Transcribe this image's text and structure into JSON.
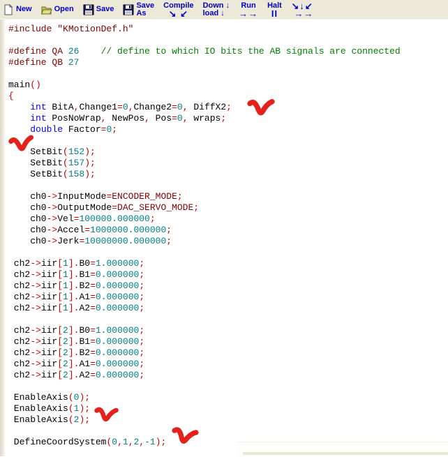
{
  "toolbar": {
    "text_color": "#0000C8",
    "background": "#ECE9D8",
    "buttons": [
      {
        "id": "new",
        "icon": "new-page-icon",
        "lines": [
          "New"
        ]
      },
      {
        "id": "open",
        "icon": "open-folder-icon",
        "lines": [
          "Open"
        ]
      },
      {
        "id": "save",
        "icon": "save-floppy-icon",
        "lines": [
          "Save"
        ]
      },
      {
        "id": "save-as",
        "icon": "save-floppy-icon",
        "lines": [
          "Save",
          "As"
        ]
      },
      {
        "id": "compile",
        "lines": [
          "Compile",
          "↘ ↙"
        ],
        "center": true
      },
      {
        "id": "download",
        "lines": [
          "Down ↓",
          "load ↓"
        ],
        "center": false
      },
      {
        "id": "run",
        "lines": [
          "Run",
          "→→"
        ],
        "center": true
      },
      {
        "id": "halt",
        "lines": [
          "Halt",
          "II"
        ],
        "center": true
      },
      {
        "id": "compile-download-run",
        "lines": [
          "↘↓↙",
          " →→"
        ],
        "center": true
      }
    ]
  },
  "editor": {
    "background": "#FFFFFF",
    "syntax_colors": {
      "keyword": "#0000FF",
      "number": "#008080",
      "operator": "#CC0000",
      "preprocessor_and_constants": "#800000",
      "comment": "#008000",
      "plain": "#000000"
    },
    "lines": [
      [
        [
          "pre",
          "#include \"KMotionDef.h\""
        ]
      ],
      [],
      [
        [
          "pre",
          "#define QA "
        ],
        [
          "num",
          "26"
        ],
        [
          "pl",
          "    "
        ],
        [
          "com",
          "// define to which IO bits the AB signals are connected"
        ]
      ],
      [
        [
          "pre",
          "#define QB "
        ],
        [
          "num",
          "27"
        ]
      ],
      [],
      [
        [
          "pl",
          "main"
        ],
        [
          "op",
          "()"
        ]
      ],
      [
        [
          "op",
          "{"
        ]
      ],
      [
        [
          "pl",
          "    "
        ],
        [
          "kw",
          "int"
        ],
        [
          "pl",
          " BitA"
        ],
        [
          "op",
          ","
        ],
        [
          "pl",
          "Change1"
        ],
        [
          "op",
          "="
        ],
        [
          "num",
          "0"
        ],
        [
          "op",
          ","
        ],
        [
          "pl",
          "Change2"
        ],
        [
          "op",
          "="
        ],
        [
          "num",
          "0"
        ],
        [
          "op",
          ","
        ],
        [
          "pl",
          " DiffX2"
        ],
        [
          "op",
          ";"
        ]
      ],
      [
        [
          "pl",
          "    "
        ],
        [
          "kw",
          "int"
        ],
        [
          "pl",
          " PosNoWrap"
        ],
        [
          "op",
          ","
        ],
        [
          "pl",
          " NewPos"
        ],
        [
          "op",
          ","
        ],
        [
          "pl",
          " Pos"
        ],
        [
          "op",
          "="
        ],
        [
          "num",
          "0"
        ],
        [
          "op",
          ","
        ],
        [
          "pl",
          " wraps"
        ],
        [
          "op",
          ";"
        ]
      ],
      [
        [
          "pl",
          "    "
        ],
        [
          "kw",
          "double"
        ],
        [
          "pl",
          " Factor"
        ],
        [
          "op",
          "="
        ],
        [
          "num",
          "0"
        ],
        [
          "op",
          ";"
        ]
      ],
      [],
      [
        [
          "pl",
          "    SetBit"
        ],
        [
          "op",
          "("
        ],
        [
          "num",
          "152"
        ],
        [
          "op",
          ");"
        ]
      ],
      [
        [
          "pl",
          "    SetBit"
        ],
        [
          "op",
          "("
        ],
        [
          "num",
          "157"
        ],
        [
          "op",
          ");"
        ]
      ],
      [
        [
          "pl",
          "    SetBit"
        ],
        [
          "op",
          "("
        ],
        [
          "num",
          "158"
        ],
        [
          "op",
          ");"
        ]
      ],
      [],
      [
        [
          "pl",
          "    ch0"
        ],
        [
          "op",
          "->"
        ],
        [
          "pl",
          "InputMode"
        ],
        [
          "op",
          "="
        ],
        [
          "pre",
          "ENCODER_MODE"
        ],
        [
          "op",
          ";"
        ]
      ],
      [
        [
          "pl",
          "    ch0"
        ],
        [
          "op",
          "->"
        ],
        [
          "pl",
          "OutputMode"
        ],
        [
          "op",
          "="
        ],
        [
          "pre",
          "DAC_SERVO_MODE"
        ],
        [
          "op",
          ";"
        ]
      ],
      [
        [
          "pl",
          "    ch0"
        ],
        [
          "op",
          "->"
        ],
        [
          "pl",
          "Vel"
        ],
        [
          "op",
          "="
        ],
        [
          "num",
          "100000.000000"
        ],
        [
          "op",
          ";"
        ]
      ],
      [
        [
          "pl",
          "    ch0"
        ],
        [
          "op",
          "->"
        ],
        [
          "pl",
          "Accel"
        ],
        [
          "op",
          "="
        ],
        [
          "num",
          "1000000.000000"
        ],
        [
          "op",
          ";"
        ]
      ],
      [
        [
          "pl",
          "    ch0"
        ],
        [
          "op",
          "->"
        ],
        [
          "pl",
          "Jerk"
        ],
        [
          "op",
          "="
        ],
        [
          "num",
          "10000000.000000"
        ],
        [
          "op",
          ";"
        ]
      ],
      [],
      [
        [
          "pl",
          " ch2"
        ],
        [
          "op",
          "->"
        ],
        [
          "pl",
          "iir"
        ],
        [
          "op",
          "["
        ],
        [
          "num",
          "1"
        ],
        [
          "op",
          "]."
        ],
        [
          "pl",
          "B0"
        ],
        [
          "op",
          "="
        ],
        [
          "num",
          "1.000000"
        ],
        [
          "op",
          ";"
        ]
      ],
      [
        [
          "pl",
          " ch2"
        ],
        [
          "op",
          "->"
        ],
        [
          "pl",
          "iir"
        ],
        [
          "op",
          "["
        ],
        [
          "num",
          "1"
        ],
        [
          "op",
          "]."
        ],
        [
          "pl",
          "B1"
        ],
        [
          "op",
          "="
        ],
        [
          "num",
          "0.000000"
        ],
        [
          "op",
          ";"
        ]
      ],
      [
        [
          "pl",
          " ch2"
        ],
        [
          "op",
          "->"
        ],
        [
          "pl",
          "iir"
        ],
        [
          "op",
          "["
        ],
        [
          "num",
          "1"
        ],
        [
          "op",
          "]."
        ],
        [
          "pl",
          "B2"
        ],
        [
          "op",
          "="
        ],
        [
          "num",
          "0.000000"
        ],
        [
          "op",
          ";"
        ]
      ],
      [
        [
          "pl",
          " ch2"
        ],
        [
          "op",
          "->"
        ],
        [
          "pl",
          "iir"
        ],
        [
          "op",
          "["
        ],
        [
          "num",
          "1"
        ],
        [
          "op",
          "]."
        ],
        [
          "pl",
          "A1"
        ],
        [
          "op",
          "="
        ],
        [
          "num",
          "0.000000"
        ],
        [
          "op",
          ";"
        ]
      ],
      [
        [
          "pl",
          " ch2"
        ],
        [
          "op",
          "->"
        ],
        [
          "pl",
          "iir"
        ],
        [
          "op",
          "["
        ],
        [
          "num",
          "1"
        ],
        [
          "op",
          "]."
        ],
        [
          "pl",
          "A2"
        ],
        [
          "op",
          "="
        ],
        [
          "num",
          "0.000000"
        ],
        [
          "op",
          ";"
        ]
      ],
      [],
      [
        [
          "pl",
          " ch2"
        ],
        [
          "op",
          "->"
        ],
        [
          "pl",
          "iir"
        ],
        [
          "op",
          "["
        ],
        [
          "num",
          "2"
        ],
        [
          "op",
          "]."
        ],
        [
          "pl",
          "B0"
        ],
        [
          "op",
          "="
        ],
        [
          "num",
          "1.000000"
        ],
        [
          "op",
          ";"
        ]
      ],
      [
        [
          "pl",
          " ch2"
        ],
        [
          "op",
          "->"
        ],
        [
          "pl",
          "iir"
        ],
        [
          "op",
          "["
        ],
        [
          "num",
          "2"
        ],
        [
          "op",
          "]."
        ],
        [
          "pl",
          "B1"
        ],
        [
          "op",
          "="
        ],
        [
          "num",
          "0.000000"
        ],
        [
          "op",
          ";"
        ]
      ],
      [
        [
          "pl",
          " ch2"
        ],
        [
          "op",
          "->"
        ],
        [
          "pl",
          "iir"
        ],
        [
          "op",
          "["
        ],
        [
          "num",
          "2"
        ],
        [
          "op",
          "]."
        ],
        [
          "pl",
          "B2"
        ],
        [
          "op",
          "="
        ],
        [
          "num",
          "0.000000"
        ],
        [
          "op",
          ";"
        ]
      ],
      [
        [
          "pl",
          " ch2"
        ],
        [
          "op",
          "->"
        ],
        [
          "pl",
          "iir"
        ],
        [
          "op",
          "["
        ],
        [
          "num",
          "2"
        ],
        [
          "op",
          "]."
        ],
        [
          "pl",
          "A1"
        ],
        [
          "op",
          "="
        ],
        [
          "num",
          "0.000000"
        ],
        [
          "op",
          ";"
        ]
      ],
      [
        [
          "pl",
          " ch2"
        ],
        [
          "op",
          "->"
        ],
        [
          "pl",
          "iir"
        ],
        [
          "op",
          "["
        ],
        [
          "num",
          "2"
        ],
        [
          "op",
          "]."
        ],
        [
          "pl",
          "A2"
        ],
        [
          "op",
          "="
        ],
        [
          "num",
          "0.000000"
        ],
        [
          "op",
          ";"
        ]
      ],
      [],
      [
        [
          "pl",
          " EnableAxis"
        ],
        [
          "op",
          "("
        ],
        [
          "num",
          "0"
        ],
        [
          "op",
          ");"
        ]
      ],
      [
        [
          "pl",
          " EnableAxis"
        ],
        [
          "op",
          "("
        ],
        [
          "num",
          "1"
        ],
        [
          "op",
          ");"
        ]
      ],
      [
        [
          "pl",
          " EnableAxis"
        ],
        [
          "op",
          "("
        ],
        [
          "num",
          "2"
        ],
        [
          "op",
          ");"
        ]
      ],
      [],
      [
        [
          "pl",
          " DefineCoordSystem"
        ],
        [
          "op",
          "("
        ],
        [
          "num",
          "0"
        ],
        [
          "op",
          ","
        ],
        [
          "num",
          "1"
        ],
        [
          "op",
          ","
        ],
        [
          "num",
          "2"
        ],
        [
          "op",
          ","
        ],
        [
          "num",
          "-1"
        ],
        [
          "op",
          ");"
        ]
      ]
    ]
  },
  "annotations": {
    "checkmark_color": "#E4211A",
    "checkmark_count": 4
  }
}
